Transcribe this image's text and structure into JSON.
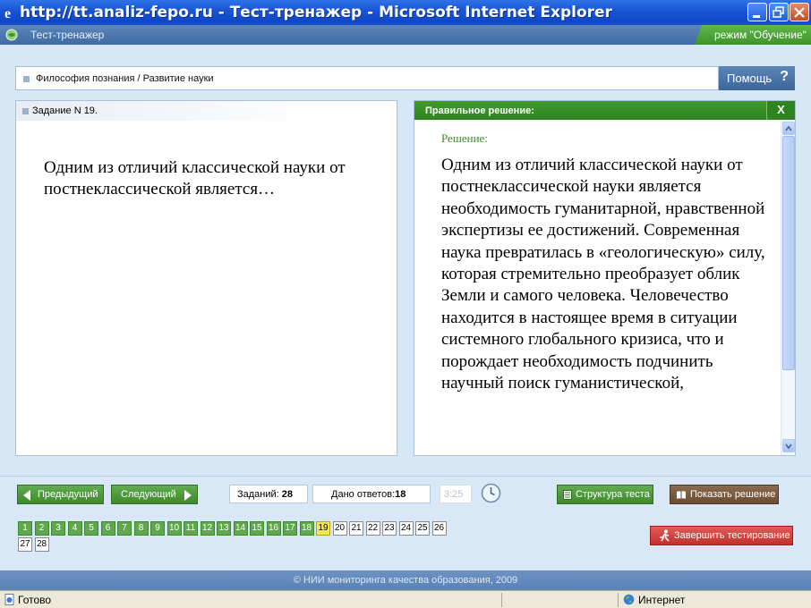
{
  "window": {
    "title": "http://tt.analiz-fepo.ru - Тест-тренажер - Microsoft Internet Explorer"
  },
  "app": {
    "title": "Тест-тренажер",
    "mode": "режим \"Обучение\""
  },
  "breadcrumb": "Философия познания / Развитие науки",
  "help": {
    "label": "Помощь",
    "icon": "?"
  },
  "task": {
    "header": "Задание N 19.",
    "question": "Одним из отличий классической науки от постнеклассической является…"
  },
  "solution_panel": {
    "header": "Правильное решение:",
    "close": "X",
    "label": "Решение:",
    "text": "Одним из отличий классической науки от постнеклассической науки является необходимость гуманитарной, нравственной экспертизы ее достижений. Современная наука  превратилась в «геологическую» силу, которая стремительно преобразует облик Земли и самого человека. Человечество находится в настоящее время в ситуации системного глобального кризиса, что и порождает необходимость подчинить научный поиск гуманистической,"
  },
  "controls": {
    "prev": "Предыдущий",
    "next": "Следующий",
    "tasks_label": "Заданий:",
    "tasks_value": "28",
    "answered_label": "Дано ответов:",
    "answered_value": "18",
    "timer": "3:25",
    "structure": "Структура теста",
    "show_solution": "Показать решение",
    "finish": "Завершить тестирование"
  },
  "question_grid": {
    "answered": [
      "1",
      "2",
      "3",
      "4",
      "5",
      "6",
      "7",
      "8",
      "9",
      "10",
      "11",
      "12",
      "13",
      "14",
      "15",
      "16",
      "17",
      "18"
    ],
    "current": "19",
    "remaining": [
      "20",
      "21",
      "22",
      "23",
      "24",
      "25",
      "26",
      "27",
      "28"
    ]
  },
  "footer": "© НИИ мониторинга качества образования, 2009",
  "status": {
    "ready": "Готово",
    "zone": "Интернет"
  },
  "colors": {
    "green": "#3d8a2c",
    "current": "#f5e84a",
    "xp_blue": "#1a56d6"
  }
}
